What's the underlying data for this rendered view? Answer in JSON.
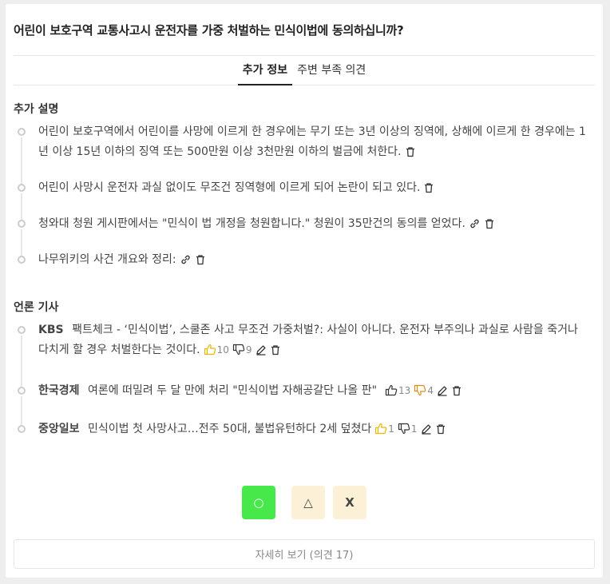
{
  "question": "어린이 보호구역 교통사고시 운전자를 가중 처벌하는 민식이법에 동의하십니까?",
  "tabs": [
    {
      "label": "추가 정보"
    },
    {
      "label": "주변 부족 의견"
    }
  ],
  "extra": {
    "title": "추가 설명",
    "items": [
      {
        "text": "어린이 보호구역에서 어린이를 사망에 이르게 한 경우에는 무기 또는 3년 이상의 징역에, 상해에 이르게 한 경우에는 1년 이상 15년 이하의 징역 또는 500만원 이상 3천만원 이하의 벌금에 처한다."
      },
      {
        "text": "어린이 사망시 운전자 과실 없이도 무조건 징역형에 이르게 되어 논란이 되고 있다."
      },
      {
        "text": "청와대 청원 게시판에서는 \"민식이 법 개정을 청원합니다.\" 청원이 35만건의 동의를 얻었다."
      },
      {
        "text": "나무위키의 사건 개요와 정리:"
      }
    ]
  },
  "news": {
    "title": "언론 기사",
    "items": [
      {
        "source": "KBS",
        "text": "팩트체크 - ‘민식이법’, 스쿨존 사고 무조건 가중처벌?: 사실이 아니다. 운전자 부주의나 과실로 사람을 죽거나 다치게 할 경우 처벌한다는 것이다.",
        "likes": "10",
        "dislikes": "9"
      },
      {
        "source": "한국경제",
        "text": "여론에 떠밀려 두 달 만에 처리 \"민식이법 자해공갈단 나올 판\"",
        "likes": "13",
        "dislikes": "4"
      },
      {
        "source": "중앙일보",
        "text": "민식이법 첫 사망사고…전주 50대, 불법유턴하다 2세 덮쳤다",
        "likes": "1",
        "dislikes": "1"
      }
    ]
  },
  "vote": {
    "o": "○",
    "t": "△",
    "x": "X"
  },
  "more_label": "자세히 보기 (의견 17)",
  "colors": {
    "o_button": "#47e94a",
    "tx_button": "#fcf1d7",
    "like_active": "#e6b800",
    "dislike_active": "#e08a1c"
  },
  "icons": [
    "trash-icon",
    "link-icon",
    "thumbs-up-icon",
    "thumbs-down-icon",
    "pencil-icon"
  ]
}
